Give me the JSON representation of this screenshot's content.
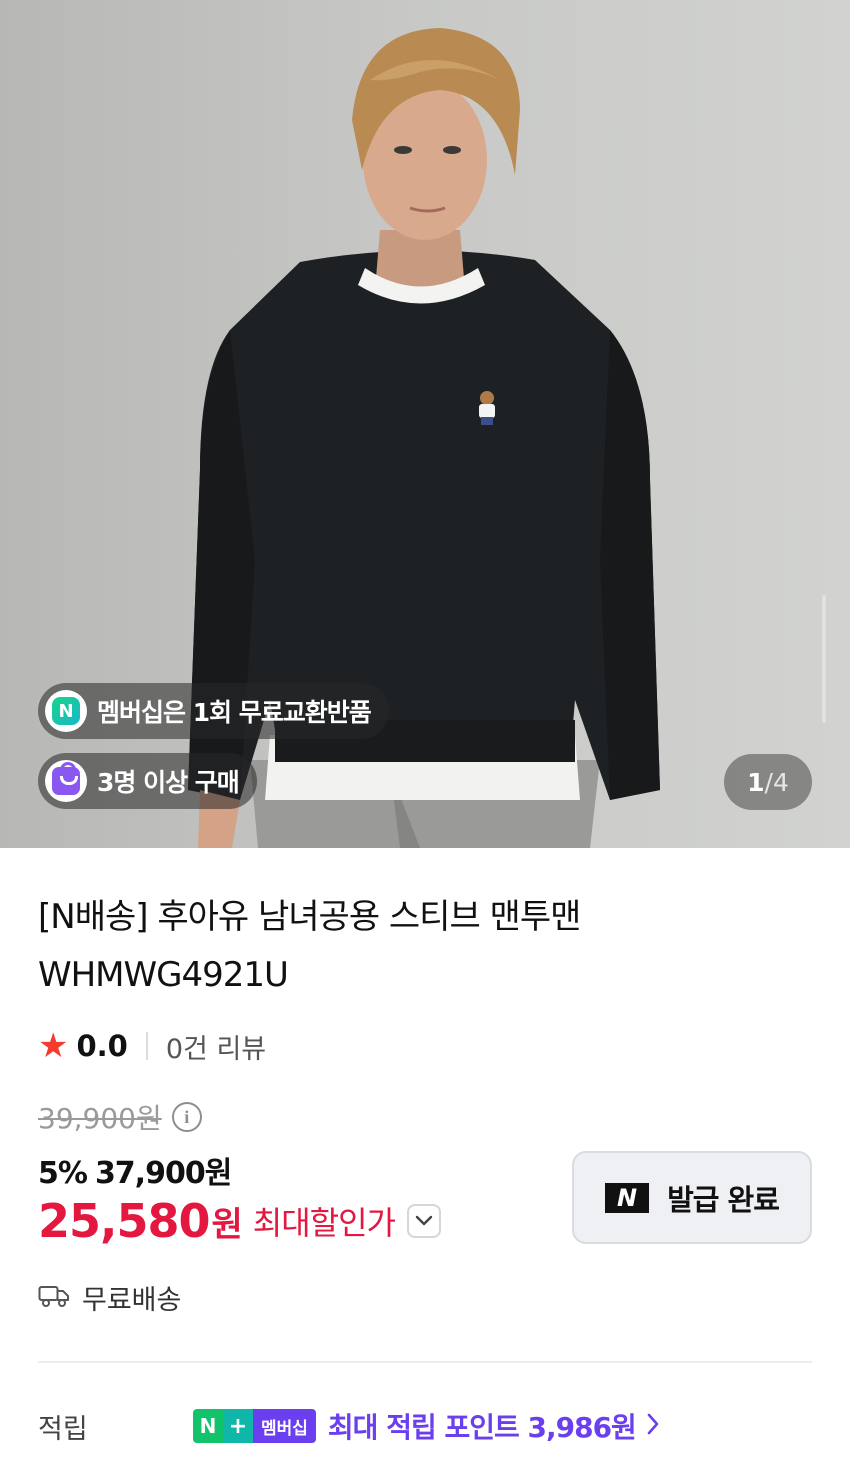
{
  "gallery": {
    "badges": [
      {
        "label": "멤버십은 1회 무료교환반품",
        "icon": "n-membership-icon"
      },
      {
        "label": "3명 이상 구매",
        "icon": "shopping-bag-icon"
      }
    ],
    "counter": {
      "current": "1",
      "separator": "/",
      "total": "4"
    }
  },
  "product": {
    "title": "[N배송] 후아유 남녀공용 스티브 맨투맨 WHMWG4921U",
    "rating": {
      "score": "0.0",
      "reviews": "0건 리뷰"
    },
    "original_price": "39,900원",
    "discount_percent": "5%",
    "sale_price": "37,900원",
    "max_discount_price": {
      "amount": "25,580",
      "currency": "원",
      "label": "최대할인가"
    },
    "coupon": {
      "logo": "N",
      "label": "발급 완료"
    },
    "shipping": "무료배송"
  },
  "points": {
    "label": "적립",
    "badge": {
      "n": "N",
      "plus": "+",
      "membership": "멤버십"
    },
    "text": "최대 적립 포인트 3,986원"
  },
  "colors": {
    "price_red": "#e3173f",
    "membership_purple": "#6b3ff0",
    "star": "#f43c2e"
  }
}
